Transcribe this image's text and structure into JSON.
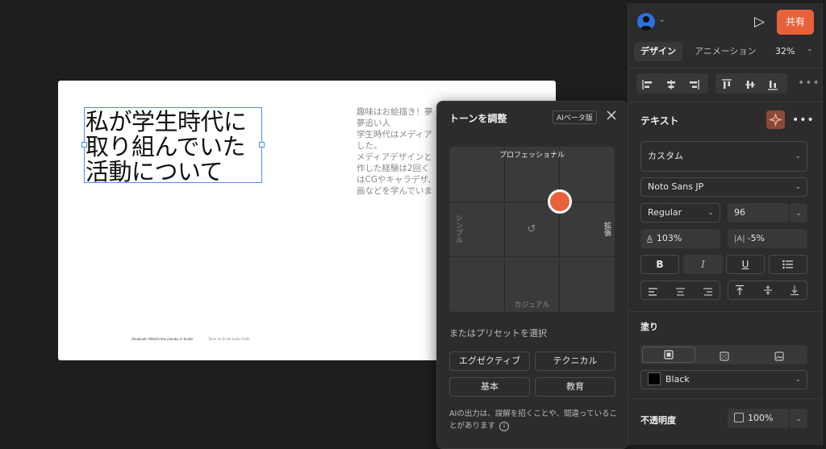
{
  "slide": {
    "title": "私が学生時代に\n取り組んでいた\n活動について",
    "body": "趣味はお絵描き！夢\n夢追い人\n学生時代はメディア\nした。\nメディアデザインと\n作した経験は2回く\nはCGやキャラデザ、\n画などを学んでいま",
    "footer_left": "Utsukushi Hitoshi kou jinsuku ni tsuite",
    "footer_mid": "Taste no Jinsei-tsuku Slide"
  },
  "tone_panel": {
    "title": "トーンを調整",
    "badge": "AIベータ版",
    "close_icon": "close-icon",
    "axis_top": "プロフェッショナル",
    "axis_bottom": "カジュアル",
    "axis_left": "シンプル",
    "axis_right": "拡張",
    "reset_icon": "↺",
    "knob_position": {
      "horizontal": 0.67,
      "vertical": 0.33
    },
    "preset_label": "またはプリセットを選択",
    "presets": [
      "エグゼクティブ",
      "テクニカル",
      "基本",
      "教育"
    ],
    "disclaimer": "AIの出力は、誤解を招くことや、間違っていることがあります"
  },
  "design_panel": {
    "play_icon": "▷",
    "share_label": "共有",
    "share_color": "#e8613a",
    "tabs": [
      "デザイン",
      "アニメーション"
    ],
    "zoom": "32%",
    "text_section": {
      "title": "テキスト",
      "style_preset": "カスタム",
      "font_family": "Noto Sans JP",
      "font_weight": "Regular",
      "font_size": "96",
      "line_height": "103%",
      "letter_spacing": "-5%"
    },
    "fill_section": {
      "title": "塗り",
      "color_name": "Black",
      "color_hex": "#000000"
    },
    "opacity_section": {
      "title": "不透明度",
      "value": "100%"
    }
  }
}
